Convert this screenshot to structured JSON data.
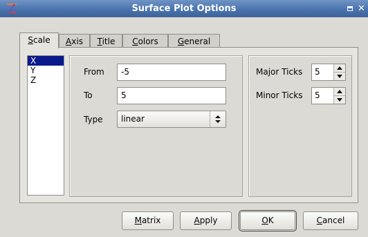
{
  "window": {
    "title": "Surface Plot Options"
  },
  "tabs": [
    {
      "label": "Scale",
      "mnemonic": "S",
      "rest": "cale"
    },
    {
      "label": "Axis",
      "mnemonic": "A",
      "rest": "xis"
    },
    {
      "label": "Title",
      "mnemonic": "T",
      "rest": "itle"
    },
    {
      "label": "Colors",
      "mnemonic": "C",
      "rest": "olors"
    },
    {
      "label": "General",
      "mnemonic": "G",
      "rest": "eneral"
    }
  ],
  "active_tab": "Scale",
  "axes": [
    "X",
    "Y",
    "Z"
  ],
  "selected_axis": "X",
  "range": {
    "from_label": "From",
    "from_value": "-5",
    "to_label": "To",
    "to_value": "5",
    "type_label": "Type",
    "type_value": "linear"
  },
  "ticks": {
    "major_label": "Major Ticks",
    "major_value": "5",
    "minor_label": "Minor Ticks",
    "minor_value": "5"
  },
  "buttons": [
    {
      "label": "Matrix",
      "mnemonic": "M",
      "rest": "atrix"
    },
    {
      "label": "Apply",
      "mnemonic": "A",
      "rest": "pply"
    },
    {
      "label": "OK",
      "mnemonic": "O",
      "rest": "K"
    },
    {
      "label": "Cancel",
      "mnemonic": "C",
      "rest": "ancel"
    }
  ],
  "colors": {
    "titlebar": "#4a73ad",
    "selection": "#0a1a8c"
  }
}
